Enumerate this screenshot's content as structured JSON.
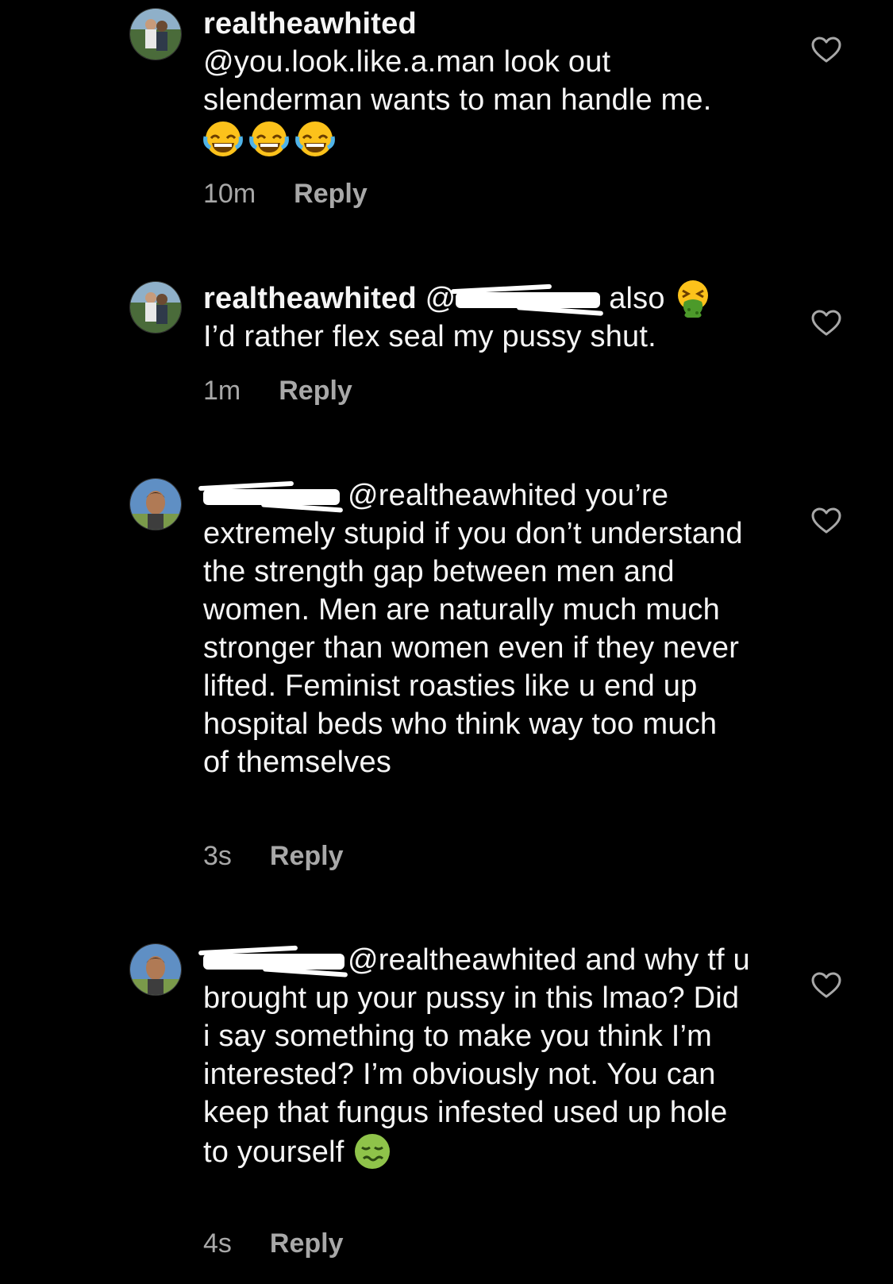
{
  "comments": [
    {
      "username": "realtheawhited",
      "text": "@you.look.like.a.man look out slenderman wants to man handle me.",
      "emojis": [
        "joy-emoji",
        "joy-emoji",
        "joy-emoji"
      ],
      "time": "10m",
      "reply_label": "Reply"
    },
    {
      "username": "realtheawhited",
      "mention_prefix": "@",
      "text_line1": "also",
      "text_line2": "I’d rather flex seal my pussy shut.",
      "emojis": [
        "vomiting-emoji"
      ],
      "time": "1m",
      "reply_label": "Reply"
    },
    {
      "text": "@realtheawhited you’re extremely stupid if you don’t understand the strength gap between men and women. Men are naturally much much stronger than women even if they never lifted. Feminist roasties like u end up hospital beds who think way too much of themselves",
      "time": "3s",
      "reply_label": "Reply"
    },
    {
      "text": "@realtheawhited and why tf u brought up your pussy in this lmao? Did i say something to make you think I’m interested? I’m obviously not. You can keep that fungus infested used up hole to yourself",
      "emojis": [
        "nauseated-emoji"
      ],
      "time": "4s",
      "reply_label": "Reply"
    }
  ],
  "icons": {
    "like": "heart-outline-icon"
  },
  "colors": {
    "background": "#000000",
    "text": "#f5f5f5",
    "secondary": "#a8a8a8"
  }
}
